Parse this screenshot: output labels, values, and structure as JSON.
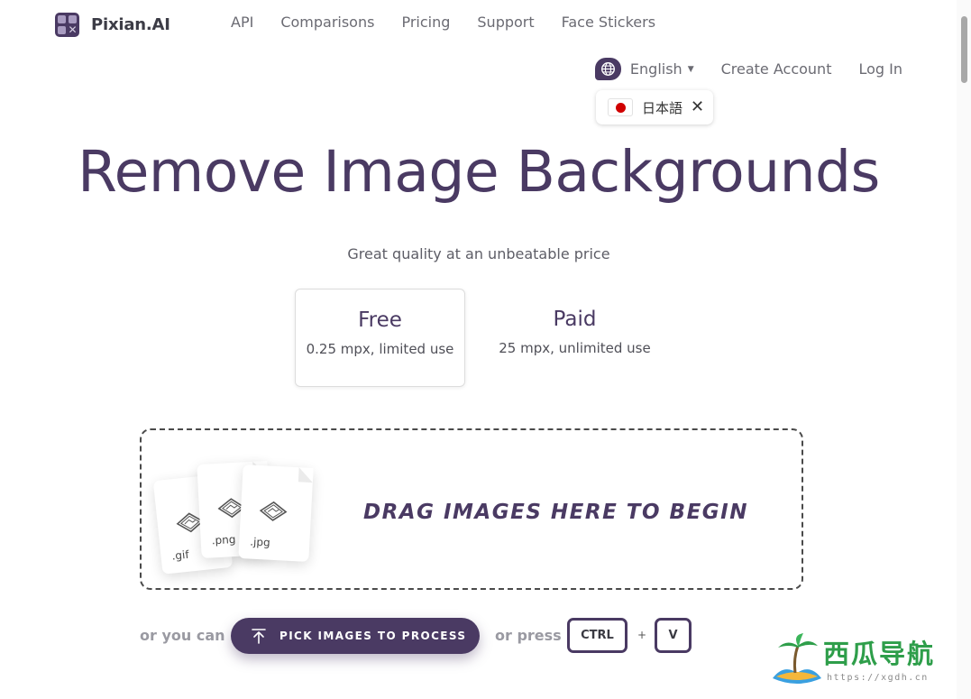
{
  "brand": {
    "name": "Pixian.AI"
  },
  "nav": {
    "links": [
      "API",
      "Comparisons",
      "Pricing",
      "Support",
      "Face Stickers"
    ],
    "language": "English",
    "create_account": "Create Account",
    "log_in": "Log In"
  },
  "lang_suggestion": {
    "label": "日本語"
  },
  "hero": {
    "title": "Remove Image Backgrounds",
    "subtitle": "Great quality at an unbeatable price"
  },
  "plans": [
    {
      "name": "Free",
      "desc": "0.25 mpx, limited use",
      "selected": true
    },
    {
      "name": "Paid",
      "desc": "25 mpx, unlimited use",
      "selected": false
    }
  ],
  "dropzone": {
    "text": "DRAG IMAGES HERE TO BEGIN",
    "file_types": [
      ".gif",
      ".png",
      ".jpg"
    ]
  },
  "actions": {
    "or_you_can": "or you can",
    "pick_button": "PICK IMAGES TO PROCESS",
    "or_press": "or press",
    "key_ctrl": "CTRL",
    "plus": "+",
    "key_v": "V"
  },
  "watermark": {
    "cn": "西瓜导航",
    "url": "https://xgdh.cn"
  },
  "colors": {
    "brand": "#4a3a63",
    "text": "#4a4a4a",
    "muted": "#9a9aa2"
  }
}
